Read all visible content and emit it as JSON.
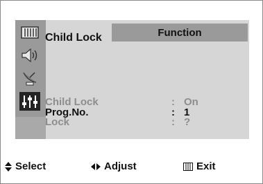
{
  "header": {
    "tab_label": "Function"
  },
  "sidebar": {
    "items": [
      {
        "icon": "picture-icon",
        "active": false
      },
      {
        "icon": "speaker-icon",
        "active": false
      },
      {
        "icon": "antenna-icon",
        "active": false
      },
      {
        "icon": "function-sliders-icon",
        "active": true
      }
    ]
  },
  "menu": {
    "title": "Child Lock",
    "rows": [
      {
        "label": "Child Lock",
        "separator": ":",
        "value": "On",
        "state": "dim"
      },
      {
        "label": "Prog.No.",
        "separator": ":",
        "value": "1",
        "state": "selected"
      },
      {
        "label": "Lock",
        "separator": ":",
        "value": "?",
        "state": "dim"
      }
    ]
  },
  "footer": {
    "select_label": "Select",
    "adjust_label": "Adjust",
    "exit_label": "Exit"
  },
  "colors": {
    "panel": "#d6d6d6",
    "sidebar": "#9a9a9a",
    "active_icon_bg": "#232323",
    "dim_text": "#8d8d8d"
  }
}
